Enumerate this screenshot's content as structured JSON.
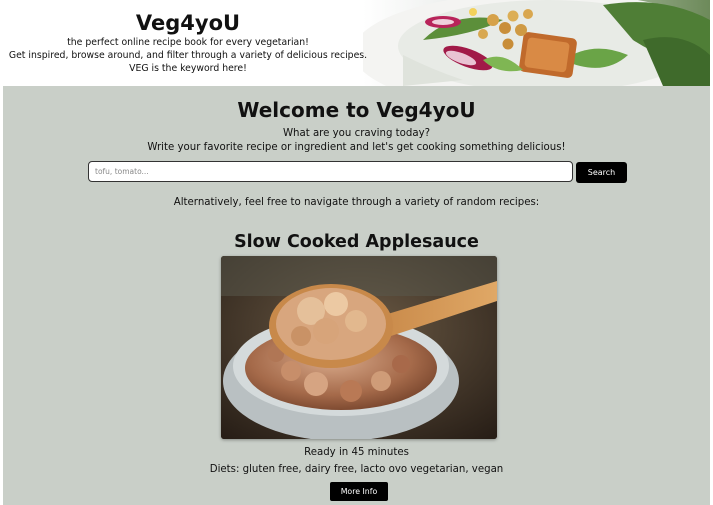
{
  "header": {
    "brand": "Veg4yoU",
    "tagline_1": "the perfect online recipe book for every vegetarian!",
    "tagline_2": "Get inspired, browse around, and filter through a variety of delicious recipes.",
    "tagline_3": "VEG is the keyword here!"
  },
  "main": {
    "welcome_title": "Welcome to Veg4yoU",
    "craving_question": "What are you craving today?",
    "craving_prompt": "Write your favorite recipe or ingredient and let's get cooking something delicious!",
    "search": {
      "value": "",
      "placeholder": "tofu, tomato...",
      "button_label": "Search"
    },
    "alternative_text": "Alternatively, feel free to navigate through a variety of random recipes:"
  },
  "recipe": {
    "title": "Slow Cooked Applesauce",
    "ready_text": "Ready in 45 minutes",
    "diets_text": "Diets: gluten free, dairy free, lacto ovo vegetarian, vegan",
    "more_info_label": "More Info"
  }
}
